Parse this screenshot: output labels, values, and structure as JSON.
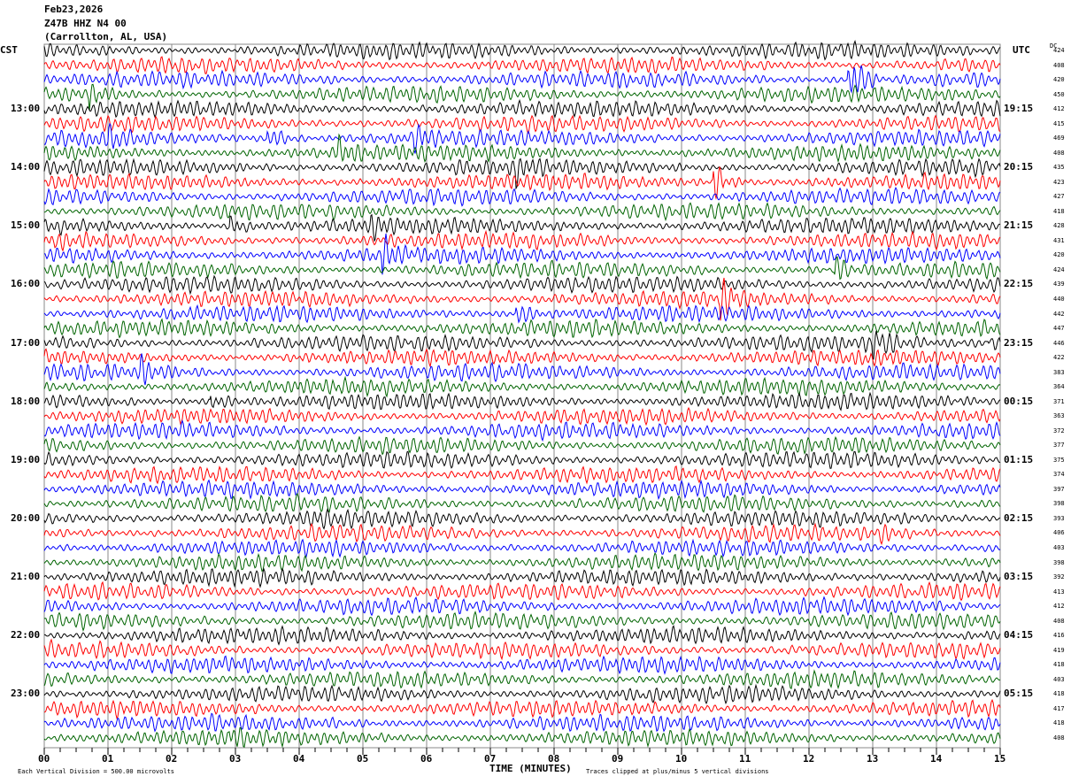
{
  "header": {
    "date": "Feb23,2026",
    "station": "Z47B HHZ N4 00",
    "location": "(Carrollton, AL, USA)"
  },
  "left_label": "CST",
  "right_label": "UTC",
  "dc_label": "DC",
  "chart_data": {
    "type": "line",
    "subtype": "helicorder",
    "xlabel": "TIME (MINUTES)",
    "xlim": [
      0,
      15
    ],
    "x_ticks": [
      "00",
      "01",
      "02",
      "03",
      "04",
      "05",
      "06",
      "07",
      "08",
      "09",
      "10",
      "11",
      "12",
      "13",
      "14",
      "15"
    ],
    "minutes_per_line": 15,
    "trace_colors": [
      "#000000",
      "#ff0000",
      "#0000ff",
      "#006400"
    ],
    "left_hour_labels": [
      {
        "row": 4,
        "label": "13:00"
      },
      {
        "row": 8,
        "label": "14:00"
      },
      {
        "row": 12,
        "label": "15:00"
      },
      {
        "row": 16,
        "label": "16:00"
      },
      {
        "row": 20,
        "label": "17:00"
      },
      {
        "row": 24,
        "label": "18:00"
      },
      {
        "row": 28,
        "label": "19:00"
      },
      {
        "row": 32,
        "label": "20:00"
      },
      {
        "row": 36,
        "label": "21:00"
      },
      {
        "row": 40,
        "label": "22:00"
      },
      {
        "row": 44,
        "label": "23:00"
      }
    ],
    "right_hour_labels": [
      {
        "row": 4,
        "label": "19:15"
      },
      {
        "row": 8,
        "label": "20:15"
      },
      {
        "row": 12,
        "label": "21:15"
      },
      {
        "row": 16,
        "label": "22:15"
      },
      {
        "row": 20,
        "label": "23:15"
      },
      {
        "row": 24,
        "label": "00:15"
      },
      {
        "row": 28,
        "label": "01:15"
      },
      {
        "row": 32,
        "label": "02:15"
      },
      {
        "row": 36,
        "label": "03:15"
      },
      {
        "row": 40,
        "label": "04:15"
      },
      {
        "row": 44,
        "label": "05:15"
      }
    ],
    "dc_values": [
      "424",
      "408",
      "420",
      "450",
      "412",
      "415",
      "469",
      "408",
      "435",
      "423",
      "427",
      "418",
      "428",
      "431",
      "420",
      "424",
      "439",
      "440",
      "442",
      "447",
      "446",
      "422",
      "383",
      "364",
      "371",
      "363",
      "372",
      "377",
      "375",
      "374",
      "397",
      "398",
      "393",
      "406",
      "403",
      "398",
      "392",
      "413",
      "412",
      "408",
      "416",
      "419",
      "418",
      "403",
      "418",
      "417",
      "418",
      "408"
    ],
    "events": [
      [
        3,
        0.7,
        2.5
      ],
      [
        2,
        12.6,
        8
      ],
      [
        6,
        1.0,
        2.2
      ],
      [
        6,
        3.5,
        3
      ],
      [
        6,
        5.8,
        3
      ],
      [
        7,
        4.6,
        2.8
      ],
      [
        8,
        7.4,
        2.2
      ],
      [
        9,
        10.5,
        3.5
      ],
      [
        12,
        2.9,
        2.2
      ],
      [
        12,
        5.1,
        2
      ],
      [
        14,
        5.3,
        3
      ],
      [
        15,
        12.4,
        2.5
      ],
      [
        17,
        10.6,
        4
      ],
      [
        18,
        7.4,
        2.2
      ],
      [
        20,
        13.0,
        3.5
      ],
      [
        20,
        14.8,
        2
      ],
      [
        22,
        1.5,
        2.5
      ],
      [
        24,
        2.6,
        2
      ],
      [
        32,
        4.2,
        1.8
      ],
      [
        33,
        13.1,
        1.6
      ],
      [
        47,
        2.9,
        1.4
      ]
    ]
  },
  "footer": {
    "scale": "Each Vertical Division =  500.00 microvolts",
    "clip": "Traces clipped at plus/minus 5 vertical divisions"
  }
}
